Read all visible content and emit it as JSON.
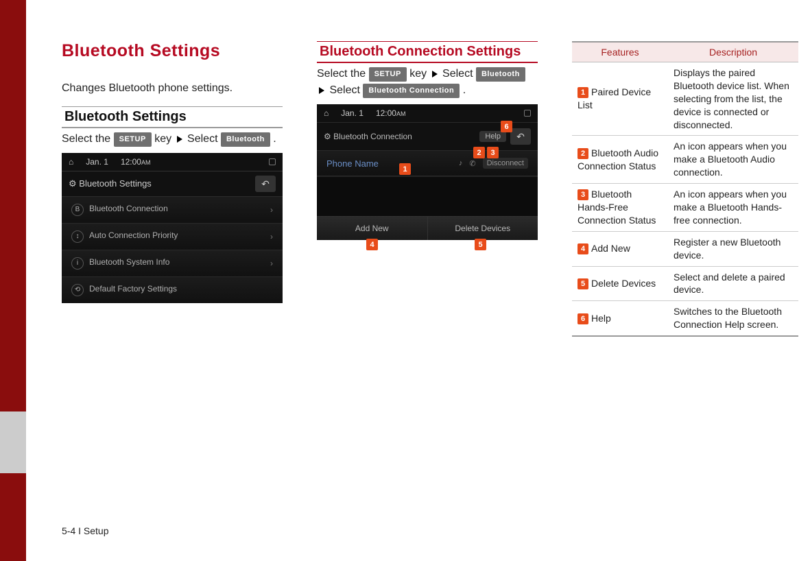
{
  "footer": "5-4 I Setup",
  "col1": {
    "title": "Bluetooth Settings",
    "intro": "Changes Bluetooth phone settings.",
    "subheading": "Bluetooth Settings",
    "step_prefix": "Select the ",
    "setup_key": "SETUP",
    "step_mid": " key ",
    "select_word": " Select ",
    "bluetooth_btn": "Bluetooth",
    "screen": {
      "date": "Jan. 1",
      "time": "12:00",
      "ampm": "AM",
      "heading": "Bluetooth Settings",
      "rows": [
        "Bluetooth Connection",
        "Auto Connection Priority",
        "Bluetooth System Info",
        "Default Factory Settings"
      ]
    }
  },
  "col2": {
    "heading": "Bluetooth Connection Settings",
    "step_prefix": "Select the ",
    "setup_key": "SETUP",
    "step_mid": " key ",
    "select_word": " Select ",
    "bluetooth_btn": "Bluetooth",
    "select_word2": " Select ",
    "btconn_btn": "Bluetooth Connection",
    "screen": {
      "date": "Jan. 1",
      "time": "12:00",
      "ampm": "AM",
      "heading": "Bluetooth Connection",
      "help": "Help",
      "phone": "Phone Name",
      "disconnect": "Disconnect",
      "add": "Add New",
      "delete": "Delete Devices"
    },
    "callouts": {
      "c1": "1",
      "c2": "2",
      "c3": "3",
      "c4": "4",
      "c5": "5",
      "c6": "6"
    }
  },
  "table": {
    "h1": "Features",
    "h2": "Description",
    "rows": [
      {
        "n": "1",
        "f": "Paired Device List",
        "d": "Displays the paired Bluetooth device list. When selecting from the list, the device is connected or disconnected."
      },
      {
        "n": "2",
        "f": "Bluetooth Audio Connection Status",
        "d": "An icon appears when you make a Bluetooth Audio connection."
      },
      {
        "n": "3",
        "f": "Bluetooth Hands-Free Connection Status",
        "d": "An icon appears when you make a Bluetooth Hands-free connection."
      },
      {
        "n": "4",
        "f": "Add New",
        "d": "Register a new Bluetooth device."
      },
      {
        "n": "5",
        "f": "Delete Devices",
        "d": "Select and delete a paired device."
      },
      {
        "n": "6",
        "f": "Help",
        "d": "Switches to the Bluetooth Connection Help screen."
      }
    ]
  }
}
